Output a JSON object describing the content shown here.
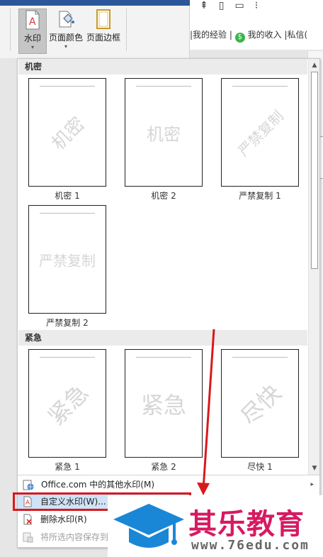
{
  "ribbon": {
    "watermark_label": "水印",
    "page_color_label": "页面颜色",
    "page_border_label": "页面边框",
    "caret": "▾"
  },
  "web": {
    "link_experience": "我的经验",
    "link_income": "我的收入",
    "link_message": "私信(",
    "sep": "|",
    "money_glyph": "$"
  },
  "gallery": {
    "sections": [
      {
        "header": "机密",
        "items": [
          {
            "caption": "机密 1",
            "watermark": "机密"
          },
          {
            "caption": "机密 2",
            "watermark": "机密"
          },
          {
            "caption": "严禁复制 1",
            "watermark": "严禁复制"
          },
          {
            "caption": "严禁复制 2",
            "watermark": "严禁复制"
          }
        ]
      },
      {
        "header": "紧急",
        "items": [
          {
            "caption": "紧急 1",
            "watermark": "紧急"
          },
          {
            "caption": "紧急 2",
            "watermark": "紧急"
          },
          {
            "caption": "尽快 1",
            "watermark": "尽快"
          }
        ]
      }
    ]
  },
  "menu": {
    "more_watermarks": "Office.com 中的其他水印(M)",
    "custom_watermark": "自定义水印(W)...",
    "remove_watermark": "删除水印(R)",
    "save_selection": "将所选内容保存到",
    "submenu_arrow": "▸"
  },
  "logo": {
    "name": "其乐教育",
    "url": "www.76edu.com"
  },
  "colors": {
    "accent_red": "#d9181d",
    "brand_magenta": "#d61a61",
    "brand_blue": "#1a87d6",
    "ribbon_blue": "#2b579a",
    "hover_blue": "#cfe3f7"
  }
}
